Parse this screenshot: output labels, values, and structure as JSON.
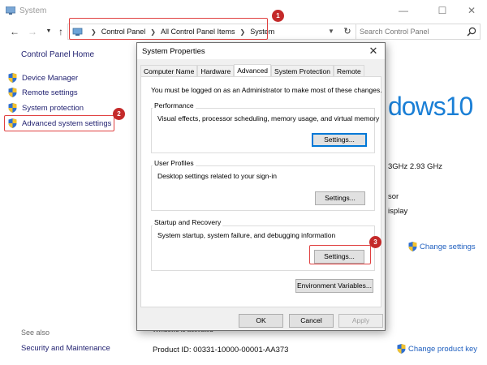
{
  "window": {
    "title": "System"
  },
  "address_bar": {
    "crumbs": [
      "Control Panel",
      "All Control Panel Items",
      "System"
    ]
  },
  "search": {
    "placeholder": "Search Control Panel"
  },
  "left_pane": {
    "home": "Control Panel Home",
    "links": [
      {
        "label": "Device Manager"
      },
      {
        "label": "Remote settings"
      },
      {
        "label": "System protection"
      },
      {
        "label": "Advanced system settings"
      }
    ],
    "see_also": "See also",
    "see_also_links": [
      "Security and Maintenance"
    ]
  },
  "background": {
    "windows_logo_text": "dows10",
    "processor_speed": "3GHz   2.93 GHz",
    "sor_text": "sor",
    "isplay_text": "isplay",
    "change_settings": "Change settings",
    "product_id": "Product ID: 00331-10000-00001-AA373",
    "change_product_key": "Change product key",
    "activated_text": "Windows is activated"
  },
  "badges": {
    "one": "1",
    "two": "2",
    "three": "3"
  },
  "dialog": {
    "title": "System Properties",
    "tabs": [
      {
        "label": "Computer Name",
        "active": false
      },
      {
        "label": "Hardware",
        "active": false
      },
      {
        "label": "Advanced",
        "active": true
      },
      {
        "label": "System Protection",
        "active": false
      },
      {
        "label": "Remote",
        "active": false
      }
    ],
    "admin_note": "You must be logged on as an Administrator to make most of these changes.",
    "performance": {
      "label": "Performance",
      "description": "Visual effects, processor scheduling, memory usage, and virtual memory",
      "button": "Settings..."
    },
    "user_profiles": {
      "label": "User Profiles",
      "description": "Desktop settings related to your sign-in",
      "button": "Settings..."
    },
    "startup_recovery": {
      "label": "Startup and Recovery",
      "description": "System startup, system failure, and debugging information",
      "button": "Settings..."
    },
    "env_button": "Environment Variables...",
    "ok": "OK",
    "cancel": "Cancel",
    "apply": "Apply"
  },
  "colors": {
    "highlight_red": "#e04040",
    "badge_red": "#c42a2a",
    "link_blue": "#1f5fbf",
    "win10_blue": "#1a7fd6"
  }
}
